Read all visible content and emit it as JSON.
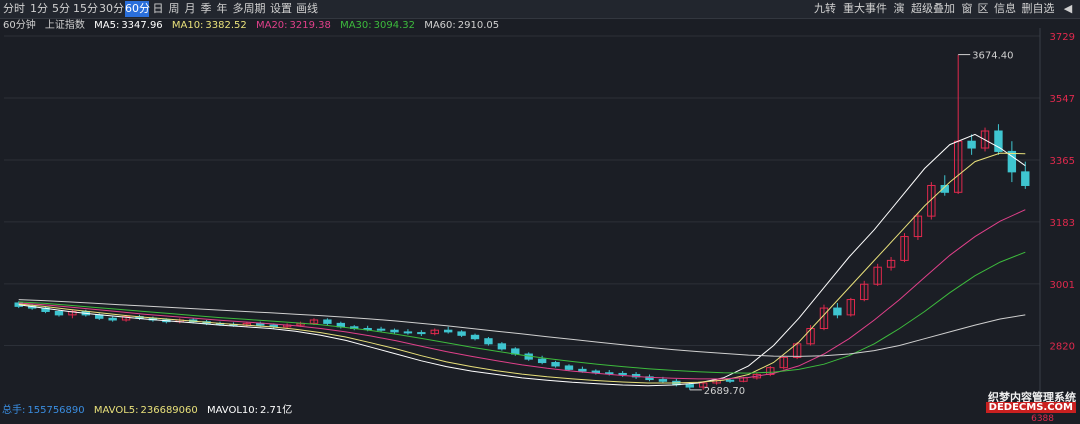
{
  "toolbar": {
    "left": [
      "分时",
      "1分",
      "5分",
      "15分",
      "30分",
      "60分",
      "日",
      "周",
      "月",
      "季",
      "年",
      "多周期",
      "设置",
      "画线"
    ],
    "active": "60分",
    "right": [
      "九转",
      "重大事件",
      "演",
      "超级叠加",
      "窗",
      "区",
      "信息",
      "删自选"
    ]
  },
  "indicator": {
    "period": "60分钟",
    "name": "上证指数",
    "ma5_label": "MA5:",
    "ma5": "3347.96",
    "ma10_label": "MA10:",
    "ma10": "3382.52",
    "ma20_label": "MA20:",
    "ma20": "3219.38",
    "ma30_label": "MA30:",
    "ma30": "3094.32",
    "ma60_label": "MA60:",
    "ma60": "2910.05"
  },
  "volume": {
    "label": "总手:",
    "value": "155756890",
    "mavol5_label": "MAVOL5:",
    "mavol5": "236689060",
    "mavol10_label": "MAVOL10:",
    "mavol10": "2.71亿",
    "axis_tick": "6388"
  },
  "colors": {
    "up": "#e0294d",
    "down": "#3fc5d0",
    "ma5": "#ffffff",
    "ma10": "#e8e07a",
    "ma20": "#e0408a",
    "ma30": "#3dbb3d",
    "ma60": "#d0d0d0",
    "axis_text": "#e0294d"
  },
  "watermark": {
    "line1": "织梦内容管理系统",
    "line2": "DEDECMS.COM"
  },
  "chart_data": {
    "type": "candlestick",
    "title": "上证指数 60分钟",
    "y_ticks": [
      3729,
      3547,
      3365,
      3183,
      3001,
      2820
    ],
    "ylim": [
      2660,
      3729
    ],
    "annotations": [
      {
        "label": "3674.40",
        "value": 3674.4,
        "kind": "high"
      },
      {
        "label": "2689.70",
        "value": 2689.7,
        "kind": "low"
      }
    ],
    "ohlc_sampled": [
      [
        2945,
        2950,
        2930,
        2935
      ],
      [
        2935,
        2940,
        2925,
        2930
      ],
      [
        2930,
        2935,
        2915,
        2920
      ],
      [
        2920,
        2925,
        2905,
        2910
      ],
      [
        2910,
        2925,
        2900,
        2920
      ],
      [
        2920,
        2925,
        2905,
        2910
      ],
      [
        2910,
        2915,
        2895,
        2900
      ],
      [
        2900,
        2905,
        2890,
        2895
      ],
      [
        2895,
        2910,
        2890,
        2905
      ],
      [
        2905,
        2910,
        2895,
        2900
      ],
      [
        2900,
        2905,
        2890,
        2895
      ],
      [
        2895,
        2900,
        2885,
        2890
      ],
      [
        2890,
        2900,
        2885,
        2895
      ],
      [
        2895,
        2900,
        2885,
        2890
      ],
      [
        2890,
        2895,
        2880,
        2885
      ],
      [
        2885,
        2890,
        2878,
        2882
      ],
      [
        2882,
        2888,
        2875,
        2880
      ],
      [
        2880,
        2890,
        2875,
        2885
      ],
      [
        2885,
        2890,
        2875,
        2880
      ],
      [
        2880,
        2885,
        2870,
        2875
      ],
      [
        2875,
        2885,
        2870,
        2880
      ],
      [
        2880,
        2890,
        2875,
        2885
      ],
      [
        2885,
        2900,
        2880,
        2895
      ],
      [
        2895,
        2900,
        2880,
        2885
      ],
      [
        2885,
        2890,
        2870,
        2875
      ],
      [
        2875,
        2880,
        2865,
        2870
      ],
      [
        2870,
        2878,
        2862,
        2868
      ],
      [
        2868,
        2875,
        2860,
        2865
      ],
      [
        2865,
        2870,
        2855,
        2860
      ],
      [
        2860,
        2868,
        2852,
        2858
      ],
      [
        2858,
        2865,
        2848,
        2855
      ],
      [
        2855,
        2870,
        2850,
        2865
      ],
      [
        2865,
        2875,
        2855,
        2860
      ],
      [
        2860,
        2865,
        2845,
        2850
      ],
      [
        2850,
        2855,
        2835,
        2840
      ],
      [
        2840,
        2845,
        2820,
        2825
      ],
      [
        2825,
        2830,
        2805,
        2810
      ],
      [
        2810,
        2815,
        2790,
        2795
      ],
      [
        2795,
        2800,
        2775,
        2780
      ],
      [
        2780,
        2790,
        2765,
        2770
      ],
      [
        2770,
        2775,
        2755,
        2760
      ],
      [
        2760,
        2765,
        2745,
        2750
      ],
      [
        2750,
        2758,
        2740,
        2745
      ],
      [
        2745,
        2750,
        2735,
        2740
      ],
      [
        2740,
        2748,
        2732,
        2738
      ],
      [
        2738,
        2745,
        2728,
        2735
      ],
      [
        2735,
        2742,
        2722,
        2728
      ],
      [
        2728,
        2735,
        2715,
        2720
      ],
      [
        2720,
        2728,
        2710,
        2715
      ],
      [
        2715,
        2722,
        2700,
        2705
      ],
      [
        2705,
        2712,
        2690,
        2698
      ],
      [
        2698,
        2715,
        2690,
        2710
      ],
      [
        2710,
        2722,
        2705,
        2718
      ],
      [
        2718,
        2725,
        2710,
        2715
      ],
      [
        2715,
        2728,
        2712,
        2725
      ],
      [
        2725,
        2740,
        2720,
        2735
      ],
      [
        2735,
        2760,
        2730,
        2755
      ],
      [
        2755,
        2790,
        2750,
        2785
      ],
      [
        2785,
        2830,
        2780,
        2825
      ],
      [
        2825,
        2880,
        2820,
        2870
      ],
      [
        2870,
        2940,
        2865,
        2930
      ],
      [
        2930,
        2945,
        2900,
        2910
      ],
      [
        2910,
        2960,
        2905,
        2955
      ],
      [
        2955,
        3010,
        2950,
        3000
      ],
      [
        3000,
        3060,
        2995,
        3050
      ],
      [
        3050,
        3080,
        3040,
        3070
      ],
      [
        3070,
        3150,
        3065,
        3140
      ],
      [
        3140,
        3210,
        3130,
        3200
      ],
      [
        3200,
        3300,
        3190,
        3290
      ],
      [
        3290,
        3320,
        3260,
        3270
      ],
      [
        3270,
        3674,
        3265,
        3420
      ],
      [
        3420,
        3440,
        3380,
        3400
      ],
      [
        3400,
        3460,
        3390,
        3450
      ],
      [
        3450,
        3470,
        3380,
        3390
      ],
      [
        3390,
        3420,
        3300,
        3330
      ],
      [
        3330,
        3360,
        3280,
        3290
      ]
    ],
    "series": [
      {
        "name": "MA5",
        "values": [
          2940,
          2930,
          2920,
          2912,
          2905,
          2898,
          2892,
          2886,
          2880,
          2875,
          2870,
          2862,
          2850,
          2835,
          2815,
          2795,
          2775,
          2758,
          2745,
          2735,
          2725,
          2718,
          2712,
          2708,
          2704,
          2702,
          2704,
          2710,
          2725,
          2760,
          2820,
          2900,
          2990,
          3080,
          3160,
          3250,
          3340,
          3410,
          3440,
          3400,
          3348
        ]
      },
      {
        "name": "MA10",
        "values": [
          2942,
          2935,
          2926,
          2918,
          2910,
          2903,
          2897,
          2891,
          2885,
          2880,
          2875,
          2868,
          2858,
          2845,
          2828,
          2810,
          2790,
          2772,
          2758,
          2746,
          2736,
          2728,
          2722,
          2717,
          2713,
          2710,
          2710,
          2712,
          2718,
          2735,
          2770,
          2830,
          2910,
          2990,
          3070,
          3150,
          3230,
          3300,
          3360,
          3385,
          3383
        ]
      },
      {
        "name": "MA20",
        "values": [
          2945,
          2940,
          2933,
          2926,
          2919,
          2912,
          2906,
          2900,
          2894,
          2889,
          2884,
          2878,
          2870,
          2860,
          2848,
          2834,
          2818,
          2802,
          2788,
          2775,
          2763,
          2753,
          2745,
          2738,
          2732,
          2727,
          2724,
          2722,
          2722,
          2726,
          2738,
          2760,
          2795,
          2840,
          2895,
          2955,
          3020,
          3085,
          3140,
          3185,
          3219
        ]
      },
      {
        "name": "MA30",
        "values": [
          2948,
          2944,
          2938,
          2932,
          2926,
          2920,
          2914,
          2908,
          2902,
          2897,
          2892,
          2887,
          2881,
          2873,
          2864,
          2853,
          2841,
          2828,
          2815,
          2803,
          2792,
          2782,
          2773,
          2765,
          2758,
          2752,
          2747,
          2743,
          2740,
          2739,
          2742,
          2750,
          2765,
          2790,
          2825,
          2870,
          2920,
          2975,
          3025,
          3065,
          3094
        ]
      },
      {
        "name": "MA60",
        "values": [
          2955,
          2952,
          2948,
          2944,
          2940,
          2936,
          2932,
          2928,
          2924,
          2920,
          2916,
          2912,
          2908,
          2903,
          2898,
          2892,
          2885,
          2878,
          2870,
          2862,
          2854,
          2846,
          2838,
          2830,
          2822,
          2815,
          2808,
          2802,
          2797,
          2792,
          2789,
          2788,
          2790,
          2795,
          2805,
          2820,
          2840,
          2860,
          2880,
          2898,
          2910
        ]
      }
    ]
  }
}
